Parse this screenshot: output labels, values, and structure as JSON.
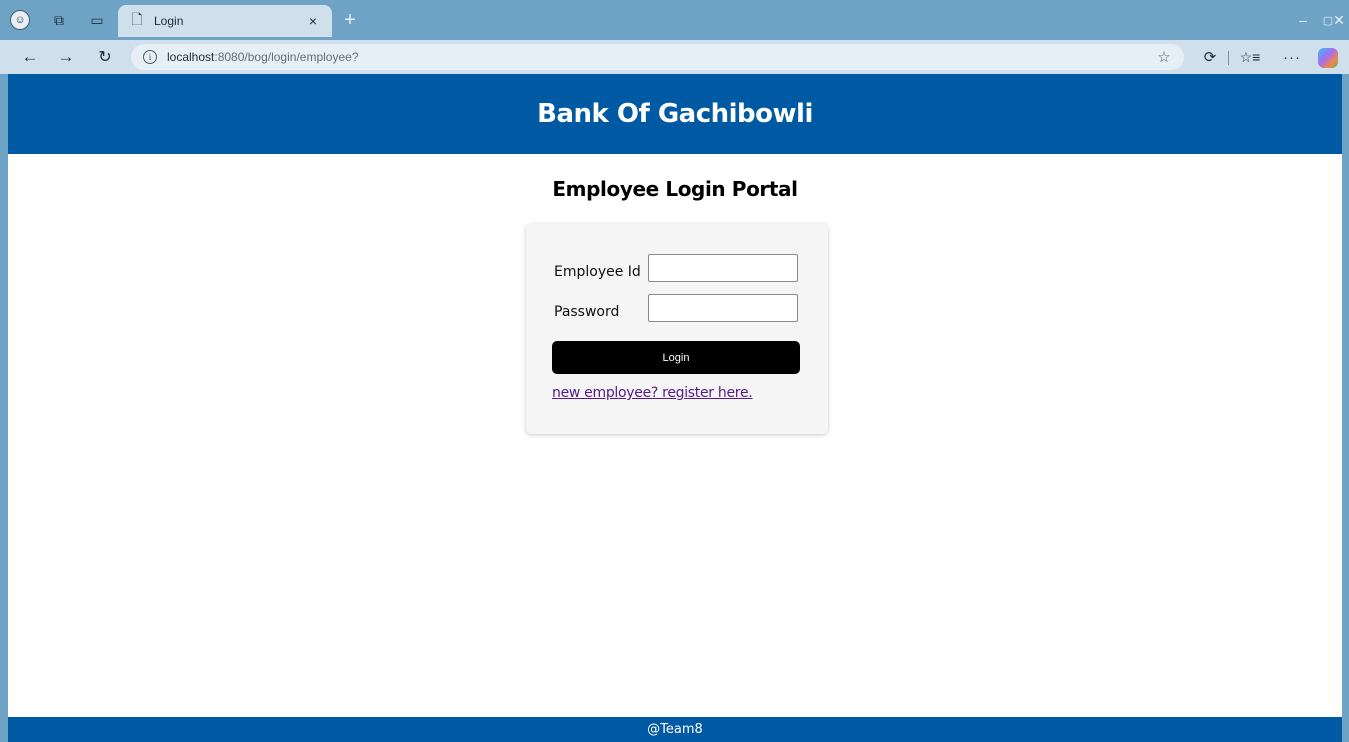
{
  "browser": {
    "tab": {
      "title": "Login",
      "close_glyph": "×"
    },
    "newtab_glyph": "+",
    "address": {
      "host": "localhost",
      "path": ":8080/bog/login/employee?"
    },
    "window_controls": {
      "minimize": "–",
      "maximize": "▢",
      "close": "✕"
    },
    "icons": {
      "profile": "profile-icon",
      "workspaces": "workspaces-icon",
      "tab_actions": "tab-actions-icon",
      "page": "page-icon",
      "back": "back-arrow-icon",
      "forward": "forward-arrow-icon",
      "reload": "reload-icon",
      "site_info": "info-icon",
      "favorite_star": "star-icon",
      "extensions": "extensions-icon",
      "favorites": "favorites-icon",
      "more": "more-icon",
      "copilot": "copilot-icon"
    }
  },
  "page": {
    "header_title": "Bank Of Gachibowli",
    "portal_title": "Employee Login Portal",
    "form": {
      "employee_id_label": "Employee Id",
      "employee_id_value": "",
      "password_label": "Password",
      "password_value": "",
      "login_button": "Login",
      "register_link": "new employee? register here."
    },
    "footer_text": "@Team8"
  },
  "colors": {
    "brand_blue": "#005aa3",
    "button_black": "#000000",
    "link_visited": "#551a8b",
    "browser_frame": "#6fa3c6"
  }
}
